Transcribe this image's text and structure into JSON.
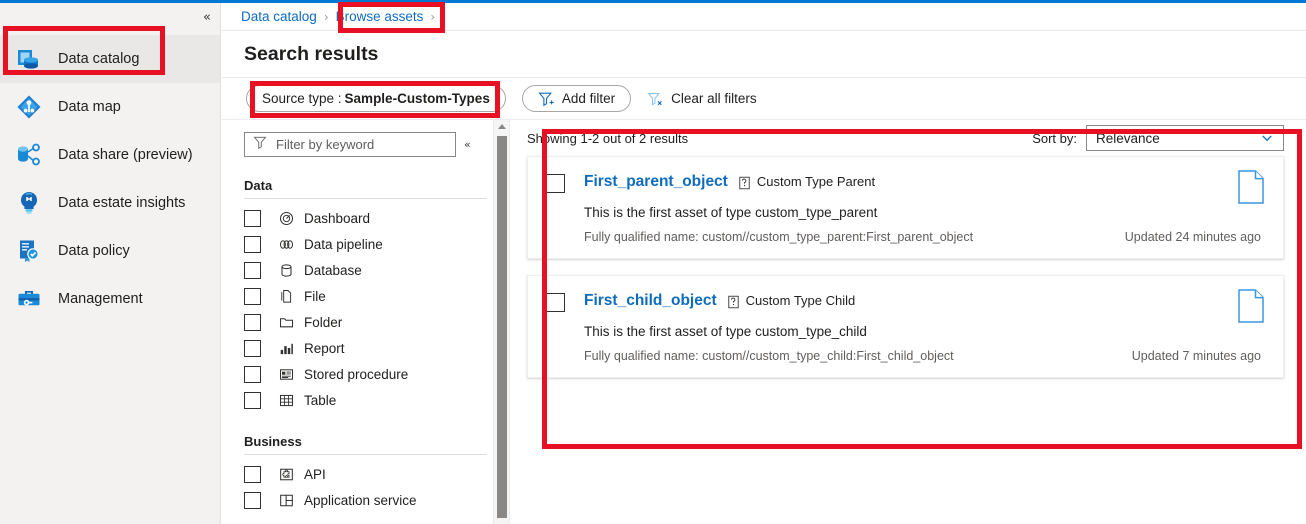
{
  "sidebar": {
    "collapse_icon": "chevron-double-left-icon",
    "items": [
      {
        "label": "Data catalog",
        "icon": "data-catalog-icon",
        "selected": true
      },
      {
        "label": "Data map",
        "icon": "data-map-icon",
        "selected": false
      },
      {
        "label": "Data share (preview)",
        "icon": "data-share-icon",
        "selected": false
      },
      {
        "label": "Data estate insights",
        "icon": "lightbulb-icon",
        "selected": false
      },
      {
        "label": "Data policy",
        "icon": "policy-certificate-icon",
        "selected": false
      },
      {
        "label": "Management",
        "icon": "toolbox-icon",
        "selected": false
      }
    ]
  },
  "breadcrumb": {
    "items": [
      "Data catalog",
      "Browse assets"
    ],
    "separator": "›"
  },
  "header": {
    "title": "Search results"
  },
  "filter_bar": {
    "source_chip_label": "Source type : ",
    "source_chip_value": "Sample-Custom-Types",
    "add_filter_label": "Add filter",
    "clear_all_label": "Clear all filters"
  },
  "facets": {
    "keyword_placeholder": "Filter by keyword",
    "keyword_value": "",
    "collapse_icon": "chevron-double-left-icon",
    "groups": [
      {
        "title": "Data",
        "options": [
          {
            "label": "Dashboard",
            "icon": "dashboard-icon",
            "checked": false
          },
          {
            "label": "Data pipeline",
            "icon": "pipeline-icon",
            "checked": false
          },
          {
            "label": "Database",
            "icon": "database-icon",
            "checked": false
          },
          {
            "label": "File",
            "icon": "file-icon",
            "checked": false
          },
          {
            "label": "Folder",
            "icon": "folder-icon",
            "checked": false
          },
          {
            "label": "Report",
            "icon": "report-bars-icon",
            "checked": false
          },
          {
            "label": "Stored procedure",
            "icon": "stored-procedure-icon",
            "checked": false
          },
          {
            "label": "Table",
            "icon": "table-grid-icon",
            "checked": false
          }
        ]
      },
      {
        "title": "Business",
        "options": [
          {
            "label": "API",
            "icon": "api-puzzle-icon",
            "checked": false
          },
          {
            "label": "Application service",
            "icon": "application-service-icon",
            "checked": false
          }
        ]
      }
    ]
  },
  "results": {
    "showing": "Showing 1-2 out of 2 results",
    "sort_label": "Sort by:",
    "sort_value": "Relevance",
    "cards": [
      {
        "name": "First_parent_object",
        "type": "Custom Type Parent",
        "description": "This is the first asset of type custom_type_parent",
        "fqn": "Fully qualified name: custom//custom_type_parent:First_parent_object",
        "updated": "Updated 24 minutes ago"
      },
      {
        "name": "First_child_object",
        "type": "Custom Type Child",
        "description": "This is the first asset of type custom_type_child",
        "fqn": "Fully qualified name: custom//custom_type_child:First_child_object",
        "updated": "Updated 7 minutes ago"
      }
    ]
  },
  "colors": {
    "accent": "#0078d4",
    "link": "#0f6cbd",
    "annotation": "#e81123",
    "sidebar_bg": "#f3f2f1"
  }
}
